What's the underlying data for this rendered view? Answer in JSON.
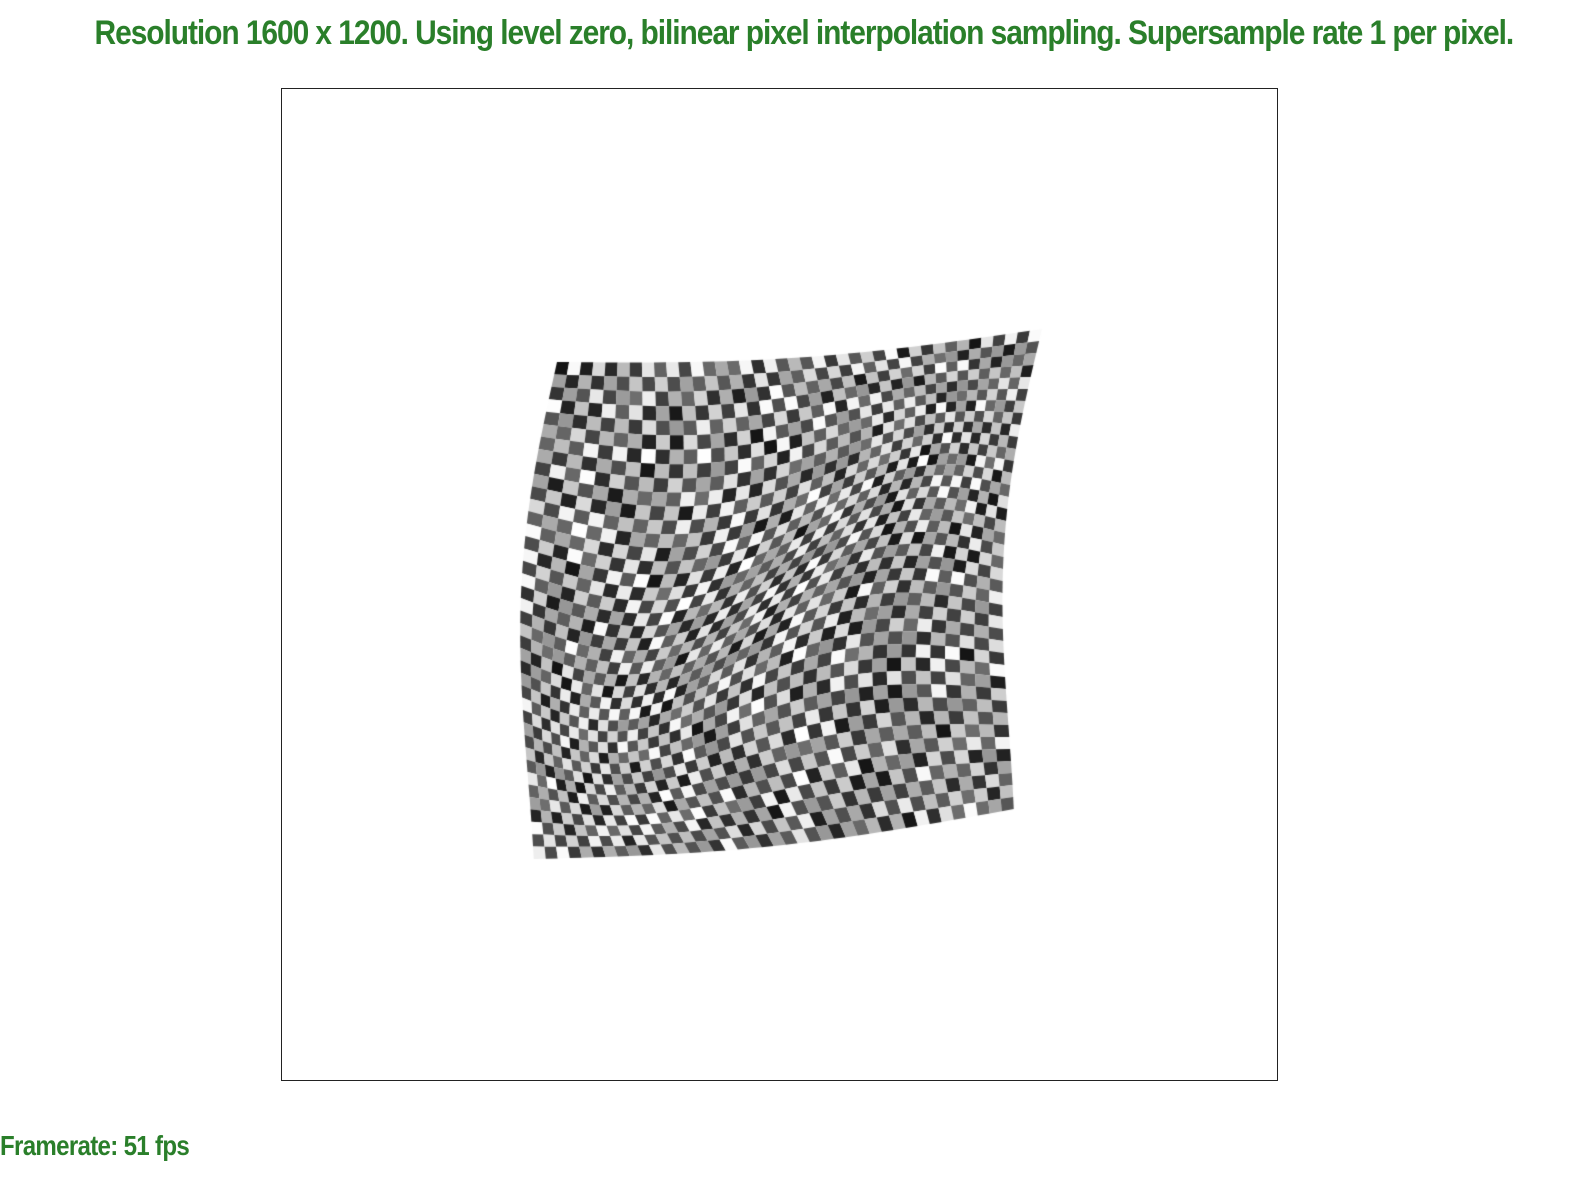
{
  "header": {
    "status_text": "Resolution 1600 x 1200. Using level zero, bilinear pixel interpolation sampling. Supersample rate 1 per pixel."
  },
  "footer": {
    "framerate_text": "Framerate: 51 fps"
  },
  "colors": {
    "text": "#2a7f2a",
    "viewport_border": "#222222",
    "background": "#ffffff"
  }
}
